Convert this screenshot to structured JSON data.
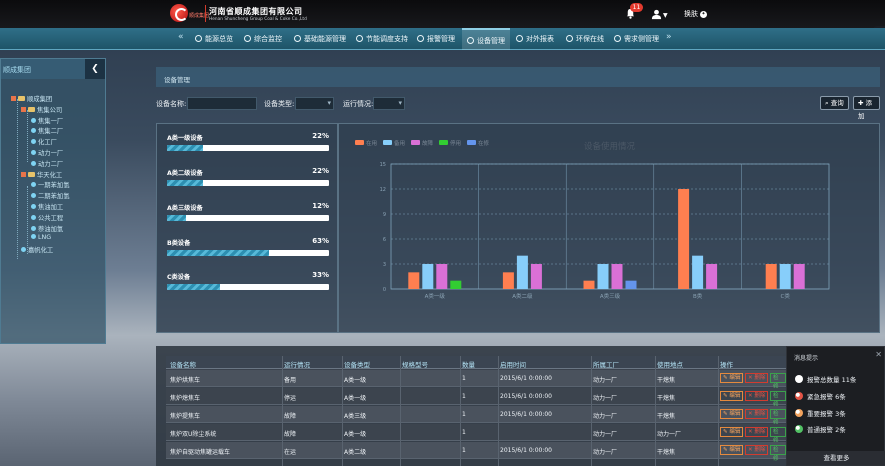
{
  "header": {
    "logo_short": "顺成集团",
    "company_cn": "河南省顺成集团有限公司",
    "company_en": "Henan Shuncheng Group Coal & Coke Co.,Ltd",
    "notification_count": "11",
    "skin_label": "换肤",
    "brand_color": "#d43b2b"
  },
  "nav": {
    "left_arrow": "«",
    "right_arrow": "»",
    "items": [
      {
        "label": "能源总览",
        "icon": "home-icon"
      },
      {
        "label": "综合监控",
        "icon": "monitor-icon"
      },
      {
        "label": "基础能源管理",
        "icon": "grid-icon"
      },
      {
        "label": "节能调度支持",
        "icon": "flag-icon"
      },
      {
        "label": "报警管理",
        "icon": "warning-icon"
      },
      {
        "label": "设备管理",
        "icon": "device-icon",
        "active": true
      },
      {
        "label": "对外报表",
        "icon": "report-icon"
      },
      {
        "label": "环保在线",
        "icon": "globe-icon"
      },
      {
        "label": "需求侧管理",
        "icon": "demand-icon"
      }
    ]
  },
  "sidebar": {
    "title": "顺成集团",
    "collapse_icon": "chevron-left-icon",
    "tree": [
      {
        "label": "顺成集团",
        "level": 0,
        "type": "folder"
      },
      {
        "label": "焦集公司",
        "level": 1,
        "type": "folder"
      },
      {
        "label": "焦集一厂",
        "level": 2,
        "type": "leaf"
      },
      {
        "label": "焦集二厂",
        "level": 2,
        "type": "leaf"
      },
      {
        "label": "化工厂",
        "level": 2,
        "type": "leaf"
      },
      {
        "label": "动力一厂",
        "level": 2,
        "type": "leaf"
      },
      {
        "label": "动力二厂",
        "level": 2,
        "type": "leaf"
      },
      {
        "label": "华天化工",
        "level": 1,
        "type": "folder"
      },
      {
        "label": "一期苯加氢",
        "level": 2,
        "type": "leaf"
      },
      {
        "label": "二期苯加氢",
        "level": 2,
        "type": "leaf"
      },
      {
        "label": "焦油加工",
        "level": 2,
        "type": "leaf"
      },
      {
        "label": "公共工程",
        "level": 2,
        "type": "leaf"
      },
      {
        "label": "萘油加氢",
        "level": 2,
        "type": "leaf"
      },
      {
        "label": "LNG",
        "level": 2,
        "type": "leaf"
      },
      {
        "label": "嘉帆化工",
        "level": 1,
        "type": "leaf"
      }
    ]
  },
  "panel": {
    "title": "设备管理",
    "filters": {
      "name_label": "设备名称:",
      "type_label": "设备类型:",
      "status_label": "运行情况:"
    },
    "search_btn": "查询",
    "add_btn": "添加"
  },
  "stats": [
    {
      "label": "A类一级设备",
      "pct_text": "22%",
      "pct": 22
    },
    {
      "label": "A类二级设备",
      "pct_text": "22%",
      "pct": 22
    },
    {
      "label": "A类三级设备",
      "pct_text": "12%",
      "pct": 12
    },
    {
      "label": "B类设备",
      "pct_text": "63%",
      "pct": 63
    },
    {
      "label": "C类设备",
      "pct_text": "33%",
      "pct": 33
    }
  ],
  "chart_data": {
    "type": "bar",
    "title": "设备使用情况",
    "categories": [
      "A类一级",
      "A类二级",
      "A类三级",
      "B类",
      "C类"
    ],
    "ylim": [
      0,
      15
    ],
    "yticks": [
      0,
      3,
      6,
      9,
      12,
      15
    ],
    "grid": true,
    "legend_position": "top-left",
    "series": [
      {
        "name": "在用",
        "color": "#ff7f50",
        "values": [
          2,
          2,
          1,
          12,
          3
        ]
      },
      {
        "name": "备用",
        "color": "#87cefa",
        "values": [
          3,
          4,
          3,
          4,
          3
        ]
      },
      {
        "name": "故障",
        "color": "#da70d6",
        "values": [
          3,
          3,
          3,
          3,
          3
        ]
      },
      {
        "name": "停用",
        "color": "#32cd32",
        "values": [
          1,
          0,
          0,
          0,
          0
        ]
      },
      {
        "name": "在修",
        "color": "#6495ed",
        "values": [
          0,
          0,
          1,
          0,
          0
        ]
      }
    ]
  },
  "table": {
    "headers": [
      "设备名称",
      "运行情况",
      "设备类型",
      "规格型号",
      "数量",
      "启用时间",
      "所属工厂",
      "使用地点",
      "操作"
    ],
    "rows": [
      [
        "焦炉烘焦车",
        "备用",
        "A类一级",
        "",
        "1",
        "2015/6/1 0:00:00",
        "动力一厂",
        "干熄焦"
      ],
      [
        "焦炉熄焦车",
        "停运",
        "A类一级",
        "",
        "1",
        "2015/6/1 0:00:00",
        "动力一厂",
        "干熄焦"
      ],
      [
        "焦炉提焦车",
        "故障",
        "A类三级",
        "",
        "1",
        "2015/6/1 0:00:00",
        "动力一厂",
        "干熄焦"
      ],
      [
        "焦炉双U除尘系统",
        "故障",
        "A类一级",
        "",
        "1",
        "",
        "动力一厂",
        "动力一厂"
      ],
      [
        "焦炉自驱动焦罐运载车",
        "在运",
        "A类二级",
        "",
        "1",
        "2015/6/1 0:00:00",
        "动力一厂",
        "干熄焦"
      ]
    ],
    "op_edit": "编辑",
    "op_delete": "删除",
    "op_view": "检修"
  },
  "notify": {
    "title": "消息提示",
    "items": [
      {
        "label": "报警总数量 11条",
        "color": "#ffffff"
      },
      {
        "label": "紧急报警 6条",
        "color": "#e45446"
      },
      {
        "label": "重要报警 3条",
        "color": "#f3a35e"
      },
      {
        "label": "普通报警 2条",
        "color": "#52c265"
      }
    ],
    "more": "查看更多"
  }
}
